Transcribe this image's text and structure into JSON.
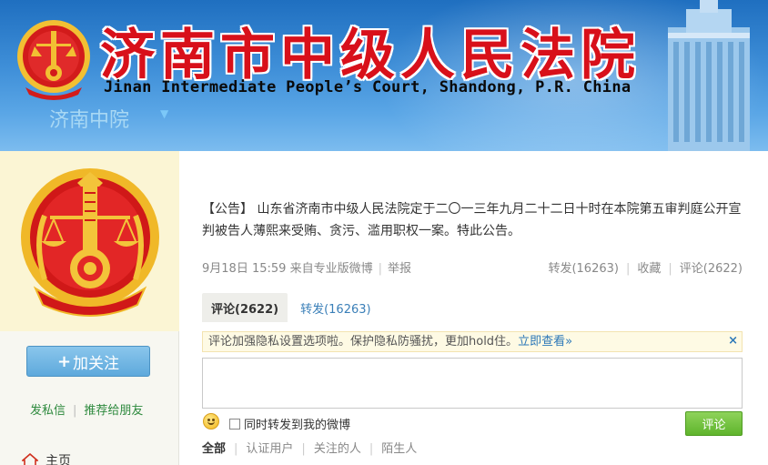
{
  "banner": {
    "court_name_cn": "济南市中级人民法院",
    "court_name_en": "Jinan Intermediate People’s Court, Shandong, P.R. China",
    "weibo_name": "济南中院",
    "colors": {
      "banner_blue": "#3f8fd8",
      "title_red": "#d8101a"
    }
  },
  "sidebar": {
    "follow_label": "加关注",
    "follow_plus": "+",
    "message_label": "发私信",
    "recommend_label": "推荐给朋友",
    "home_label": "主页"
  },
  "post": {
    "text": "【公告】 山东省济南市中级人民法院定于二〇一三年九月二十二日十时在本院第五审判庭公开宣判被告人薄熙来受贿、贪污、滥用职权一案。特此公告。",
    "time": "9月18日 15:59",
    "source": "来自专业版微博",
    "report": "举报",
    "repost": "转发(16263)",
    "favorite": "收藏",
    "comment": "评论(2622)"
  },
  "tabs": {
    "comments": "评论(2622)",
    "reposts": "转发(16263)"
  },
  "notice": {
    "text": "评论加强隐私设置选项啦。保护隐私防骚扰，更加hold住。",
    "link": "立即查看»",
    "close": "×"
  },
  "compose": {
    "placeholder": "",
    "repost_option": "同时转发到我的微博",
    "submit": "评论",
    "submit_color": "#5fb42c"
  },
  "filters": {
    "all": "全部",
    "verified": "认证用户",
    "following": "关注的人",
    "strangers": "陌生人"
  }
}
